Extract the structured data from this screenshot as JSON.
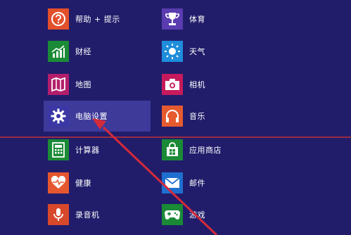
{
  "apps": {
    "col1": [
      {
        "key": "help",
        "label": "帮助 + 提示",
        "icon": "help-icon",
        "color": "#e2502c"
      },
      {
        "key": "finance",
        "label": "财经",
        "icon": "finance-chart-icon",
        "color": "#1b8a36"
      },
      {
        "key": "maps",
        "label": "地图",
        "icon": "map-icon",
        "color": "#b31e6b"
      },
      {
        "key": "pc-settings",
        "label": "电脑设置",
        "icon": "gear-icon",
        "color": "#3b37a5",
        "selected": true
      },
      {
        "key": "calculator",
        "label": "计算器",
        "icon": "calculator-icon",
        "color": "#1a8a36"
      },
      {
        "key": "health",
        "label": "健康",
        "icon": "heart-pulse-icon",
        "color": "#e5572e"
      },
      {
        "key": "sound-recorder",
        "label": "录音机",
        "icon": "microphone-icon",
        "color": "#d8482b"
      }
    ],
    "col2": [
      {
        "key": "sports",
        "label": "体育",
        "icon": "trophy-icon",
        "color": "#5a3cb0"
      },
      {
        "key": "weather",
        "label": "天气",
        "icon": "sun-icon",
        "color": "#1e8ddb"
      },
      {
        "key": "camera",
        "label": "相机",
        "icon": "camera-icon",
        "color": "#c61a5c"
      },
      {
        "key": "music",
        "label": "音乐",
        "icon": "headphones-icon",
        "color": "#e55a2e"
      },
      {
        "key": "store",
        "label": "应用商店",
        "icon": "store-bag-icon",
        "color": "#1a8a36"
      },
      {
        "key": "mail",
        "label": "邮件",
        "icon": "mail-icon",
        "color": "#1f6fd0"
      },
      {
        "key": "games",
        "label": "游戏",
        "icon": "gamepad-icon",
        "color": "#1a8a36"
      }
    ]
  },
  "annotation": {
    "arrow_color": "#d42a3a",
    "line_color": "#c43236"
  }
}
